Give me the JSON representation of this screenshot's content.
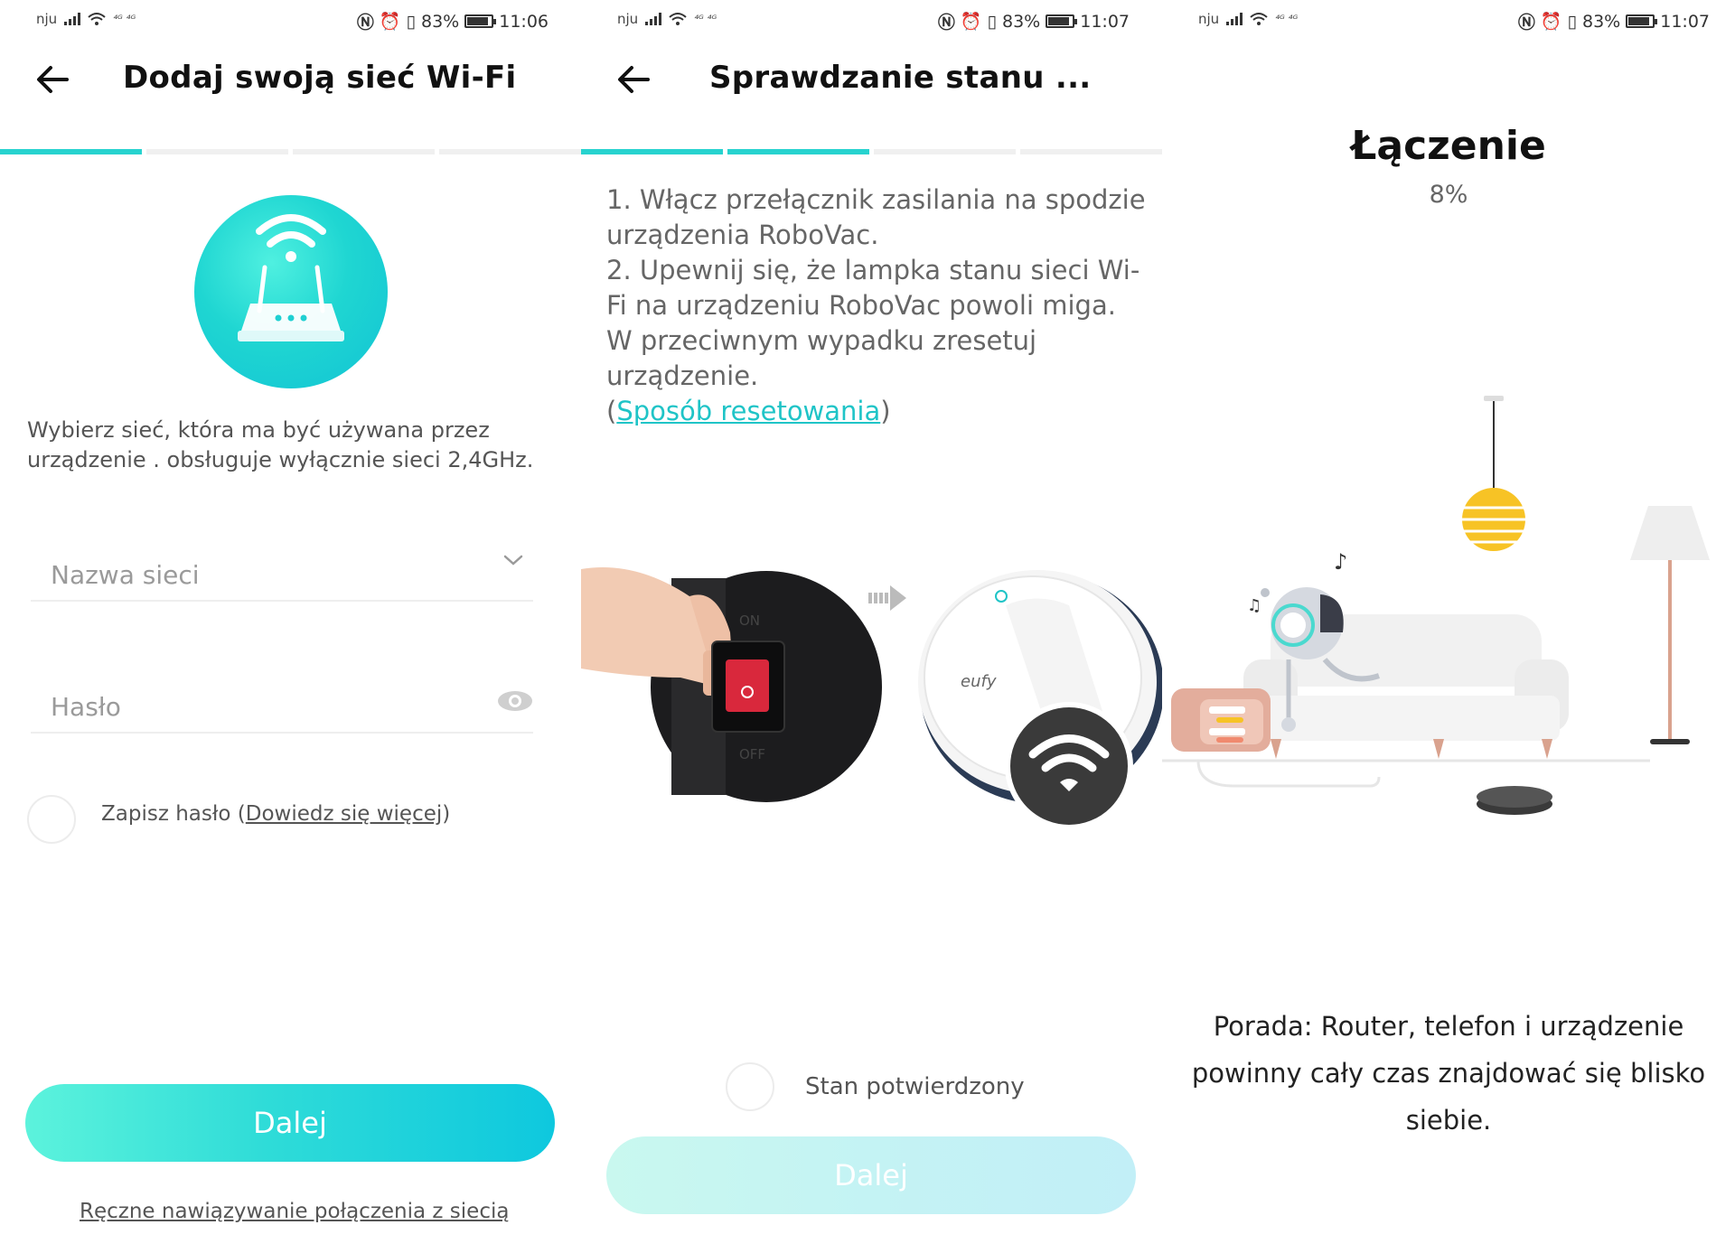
{
  "status_bar": {
    "panel1": {
      "carrier": "nju",
      "battery": "83%",
      "time": "11:06"
    },
    "panel2": {
      "carrier": "nju",
      "battery": "83%",
      "time": "11:07"
    },
    "panel3": {
      "carrier": "nju",
      "battery": "83%",
      "time": "11:07"
    }
  },
  "screen1": {
    "title": "Dodaj swoją sieć Wi-Fi",
    "steps_active": 1,
    "steps_total": 4,
    "description": "Wybierz sieć, która ma być używana przez urządzenie .  obsługuje wyłącznie sieci 2,4GHz.",
    "network_field_placeholder": "Nazwa sieci",
    "password_field_placeholder": "Hasło",
    "save_password_label": "Zapisz hasło ",
    "learn_more_open": "(",
    "learn_more_link": "Dowiedz się więcej",
    "learn_more_close": ")",
    "next_button": "Dalej",
    "manual_connect_link": "Ręczne nawiązywanie połączenia z siecią"
  },
  "screen2": {
    "title": "Sprawdzanie stanu ...",
    "steps_active": 2,
    "steps_total": 4,
    "instruction_1": "1. Włącz przełącznik zasilania na spodzie urządzenia RoboVac.",
    "instruction_2": "2. Upewnij się, że lampka stanu sieci Wi-Fi na urządzeniu RoboVac powoli miga. W przeciwnym wypadku zresetuj urządzenie.",
    "reset_open": "(",
    "reset_link": "Sposób resetowania",
    "reset_close": ")",
    "switch_on_label": "ON",
    "switch_off_label": "OFF",
    "brand_label": "eufy",
    "confirm_label": "Stan potwierdzony",
    "next_button": "Dalej"
  },
  "screen3": {
    "title": "Łączenie",
    "progress_percent": "8%",
    "tip": "Porada: Router, telefon i urządzenie powinny cały czas znajdować się blisko siebie."
  },
  "colors": {
    "accent": "#27d3cf",
    "link": "#1fc4c7",
    "step_inactive": "#f0f0f0",
    "lamp_yellow": "#f7c325"
  }
}
